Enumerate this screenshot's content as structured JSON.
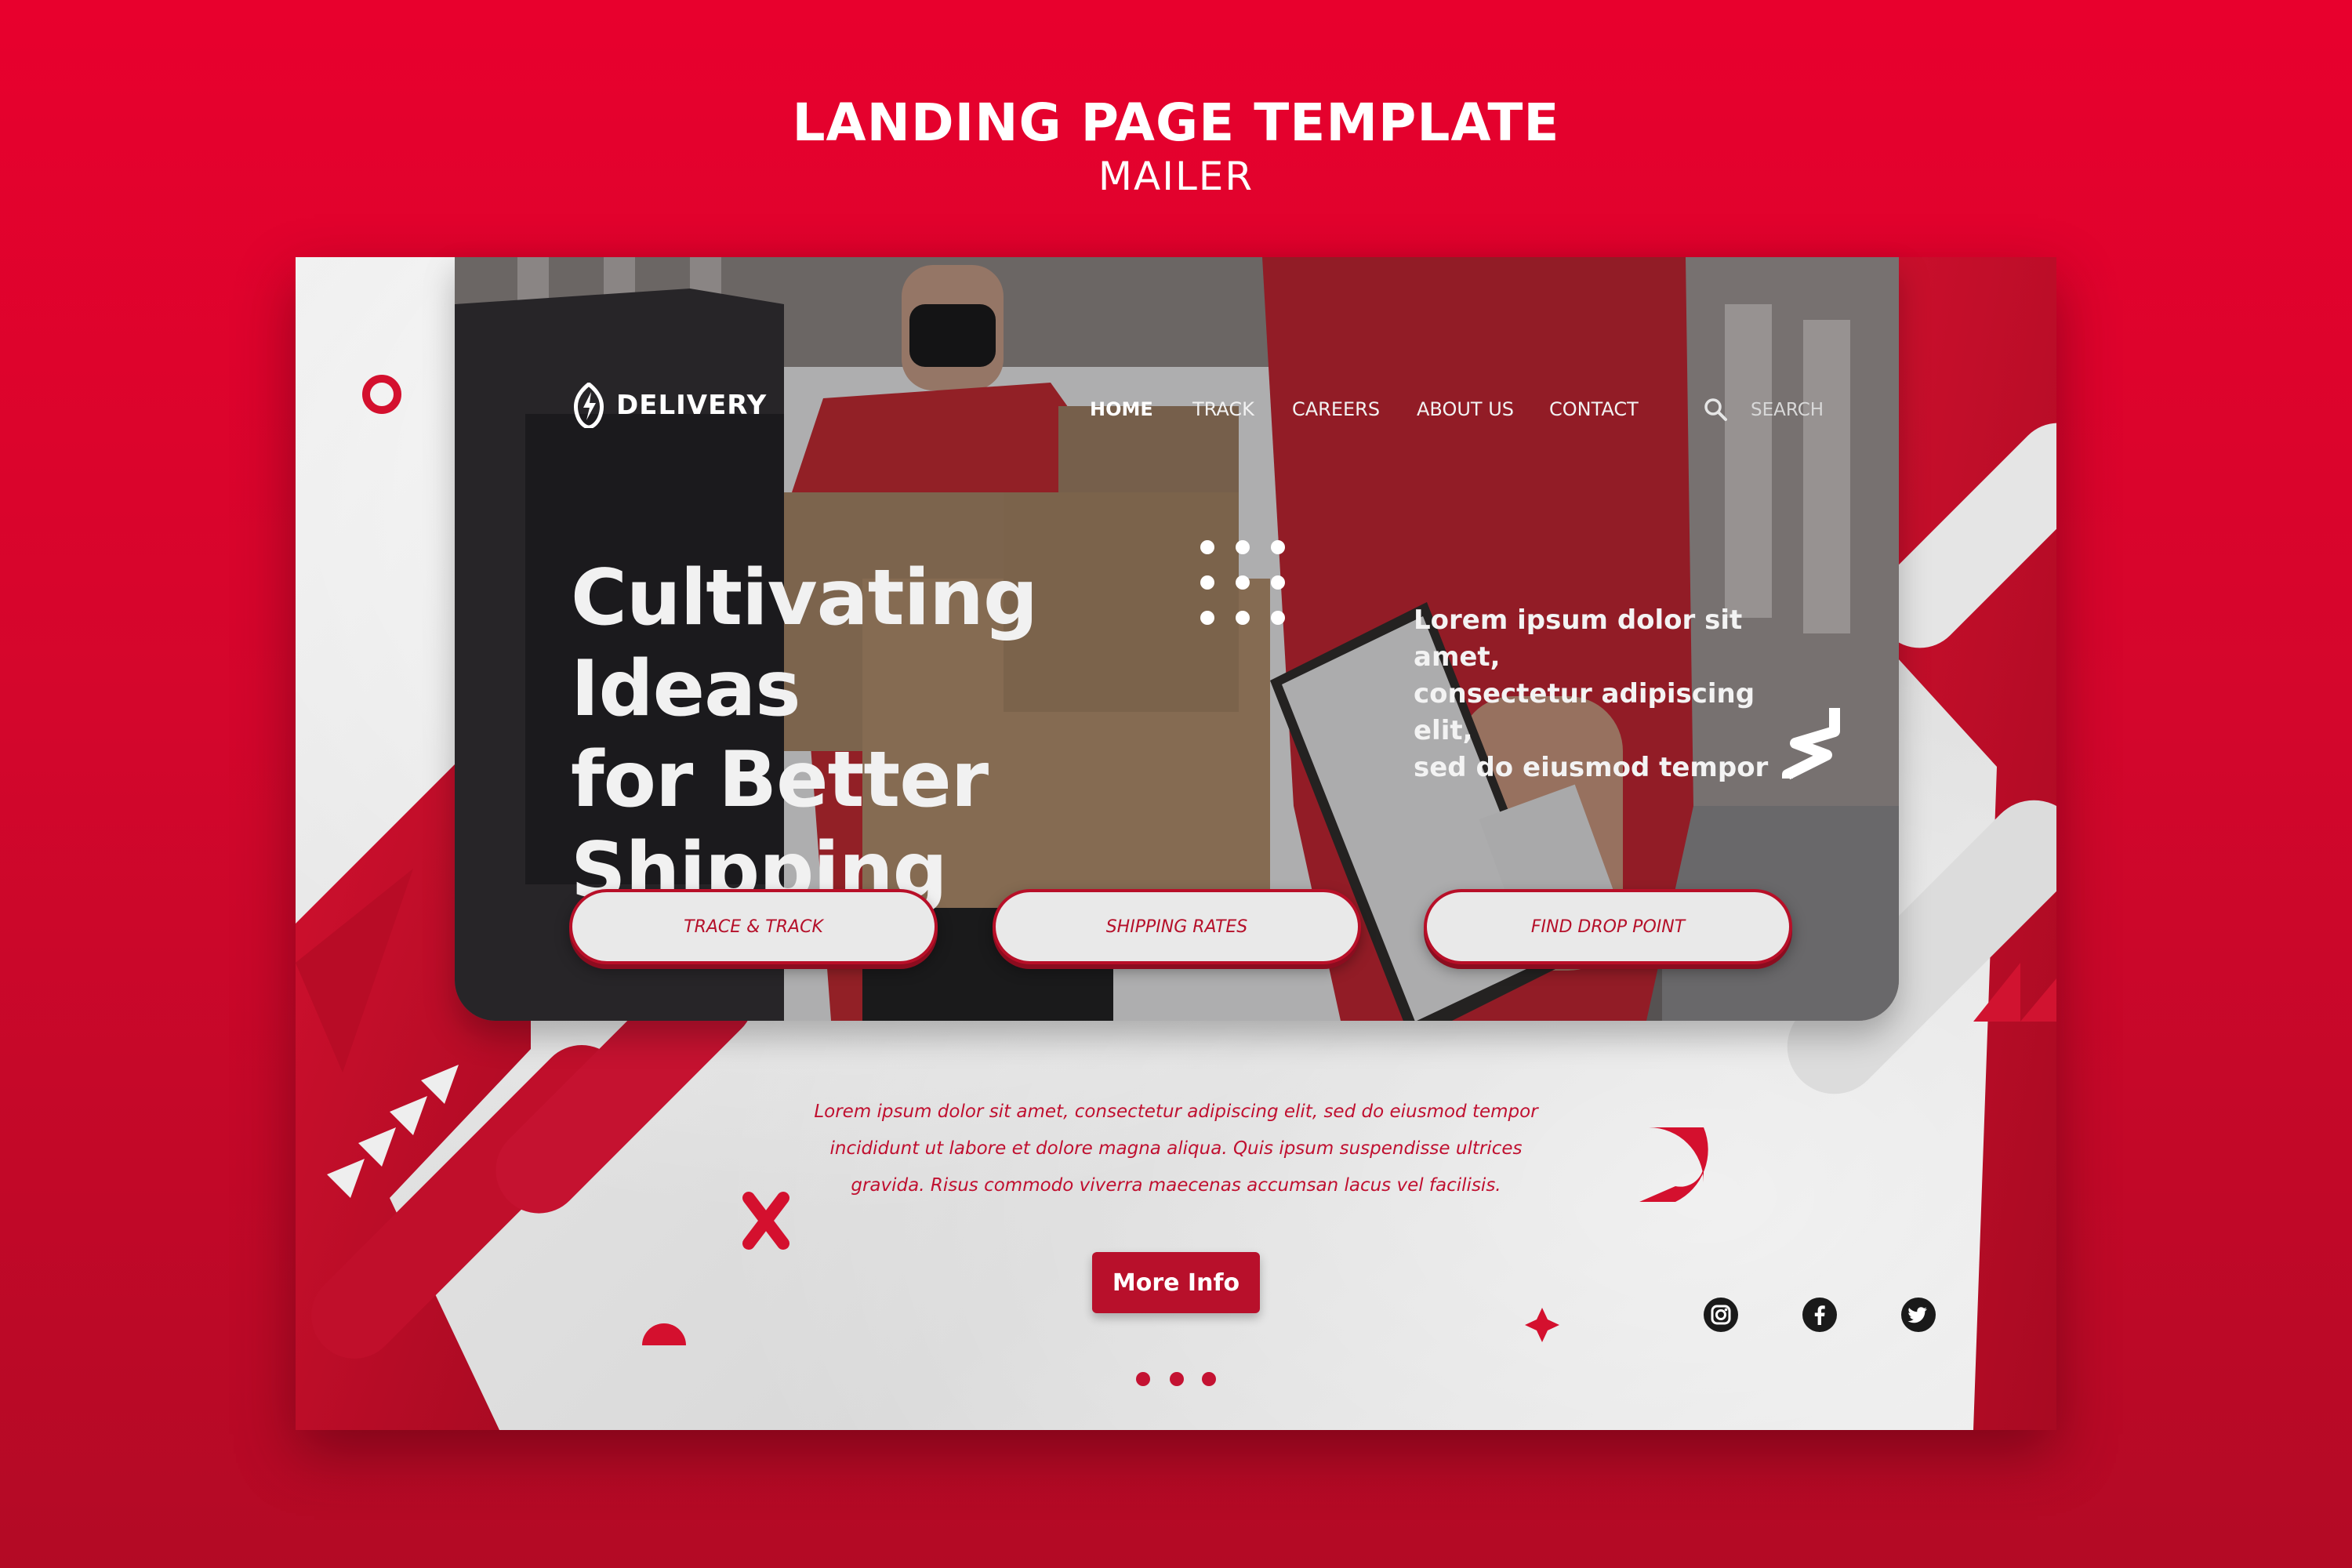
{
  "header": {
    "title": "LANDING PAGE TEMPLATE",
    "subtitle": "MAILER"
  },
  "site": {
    "brand": "DELIVERY",
    "nav": [
      "HOME",
      "TRACK",
      "CAREERS",
      "ABOUT US",
      "CONTACT"
    ],
    "active_nav": "HOME",
    "search_placeholder": "SEARCH",
    "headline_line1": "Cultivating Ideas",
    "headline_line2": "for Better Shipping",
    "side_line1": "Lorem ipsum dolor sit amet,",
    "side_line2": "consectetur adipiscing elit,",
    "side_line3": "sed do eiusmod tempor",
    "buttons": [
      "TRACE & TRACK",
      "SHIPPING RATES",
      "FIND DROP POINT"
    ],
    "body_line1": "Lorem ipsum dolor sit amet, consectetur adipiscing elit, sed do eiusmod tempor",
    "body_line2": "incididunt ut labore et dolore magna aliqua. Quis ipsum suspendisse ultrices",
    "body_line3": "gravida. Risus commodo viverra maecenas accumsan lacus vel facilisis.",
    "cta": "More Info",
    "social_icons": [
      "instagram-icon",
      "facebook-icon",
      "twitter-icon"
    ]
  },
  "colors": {
    "brand_red": "#e8002d",
    "dark_red": "#b8102b",
    "paper": "#e6e6e6"
  }
}
